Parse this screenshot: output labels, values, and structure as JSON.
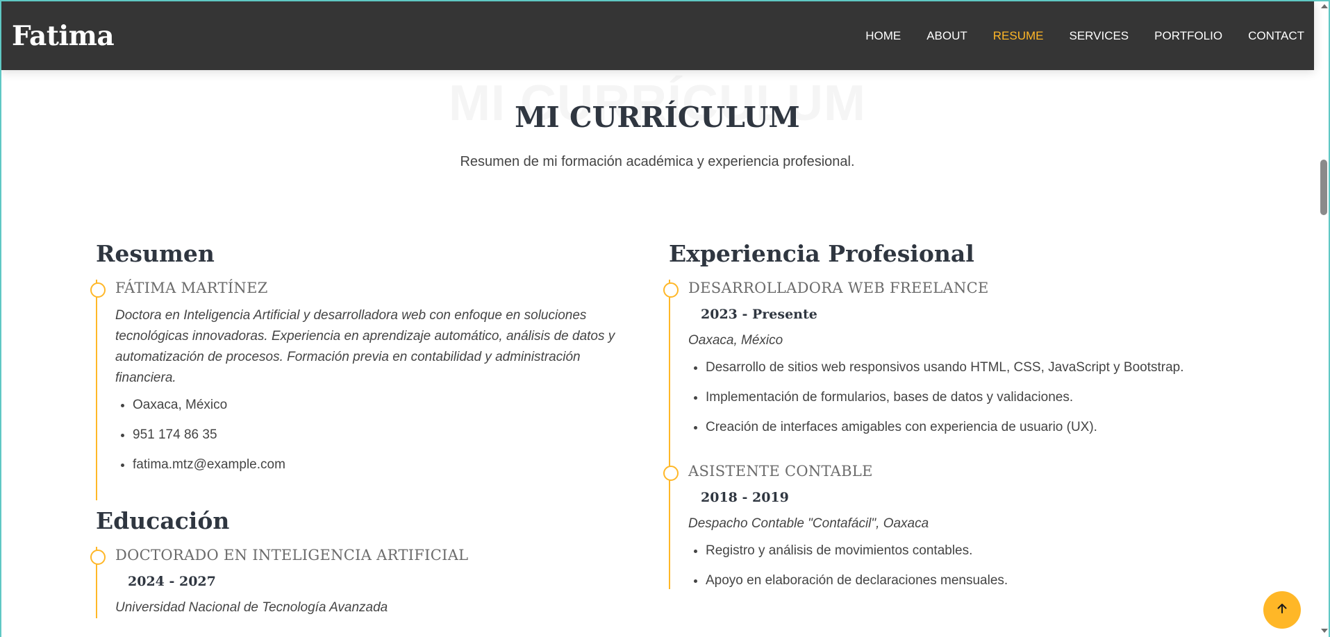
{
  "header": {
    "logo": "Fatima",
    "nav": [
      {
        "label": "HOME",
        "active": false
      },
      {
        "label": "ABOUT",
        "active": false
      },
      {
        "label": "RESUME",
        "active": true
      },
      {
        "label": "SERVICES",
        "active": false
      },
      {
        "label": "PORTFOLIO",
        "active": false
      },
      {
        "label": "CONTACT",
        "active": false
      }
    ]
  },
  "section": {
    "bg_title": "MI CURRÍCULUM",
    "title": "MI CURRÍCULUM",
    "subtitle": "Resumen de mi formación académica y experiencia profesional."
  },
  "left": {
    "resumen_title": "Resumen",
    "resumen": {
      "name": "FÁTIMA MARTÍNEZ",
      "bio": "Doctora en Inteligencia Artificial y desarrolladora web con enfoque en soluciones tecnológicas innovadoras. Experiencia en aprendizaje automático, análisis de datos y automatización de procesos. Formación previa en contabilidad y administración financiera.",
      "details": [
        "Oaxaca, México",
        "951 174 86 35",
        "fatima.mtz@example.com"
      ]
    },
    "educacion_title": "Educación",
    "educacion": {
      "degree": "DOCTORADO EN INTELIGENCIA ARTIFICIAL",
      "years": "2024 - 2027",
      "school": "Universidad Nacional de Tecnología Avanzada"
    }
  },
  "right": {
    "title": "Experiencia Profesional",
    "jobs": [
      {
        "role": "DESARROLLADORA WEB FREELANCE",
        "years": "2023 - Presente",
        "place": "Oaxaca, México",
        "tasks": [
          "Desarrollo de sitios web responsivos usando HTML, CSS, JavaScript y Bootstrap.",
          "Implementación de formularios, bases de datos y validaciones.",
          "Creación de interfaces amigables con experiencia de usuario (UX)."
        ]
      },
      {
        "role": "ASISTENTE CONTABLE",
        "years": "2018 - 2019",
        "place": "Despacho Contable \"Contafácil\", Oaxaca",
        "tasks": [
          "Registro y análisis de movimientos contables.",
          "Apoyo en elaboración de declaraciones mensuales."
        ]
      }
    ]
  },
  "colors": {
    "accent": "#ffb727",
    "header_bg": "#353535",
    "heading": "#2f3640"
  },
  "icons": {
    "back_to_top": "arrow-up-icon"
  }
}
